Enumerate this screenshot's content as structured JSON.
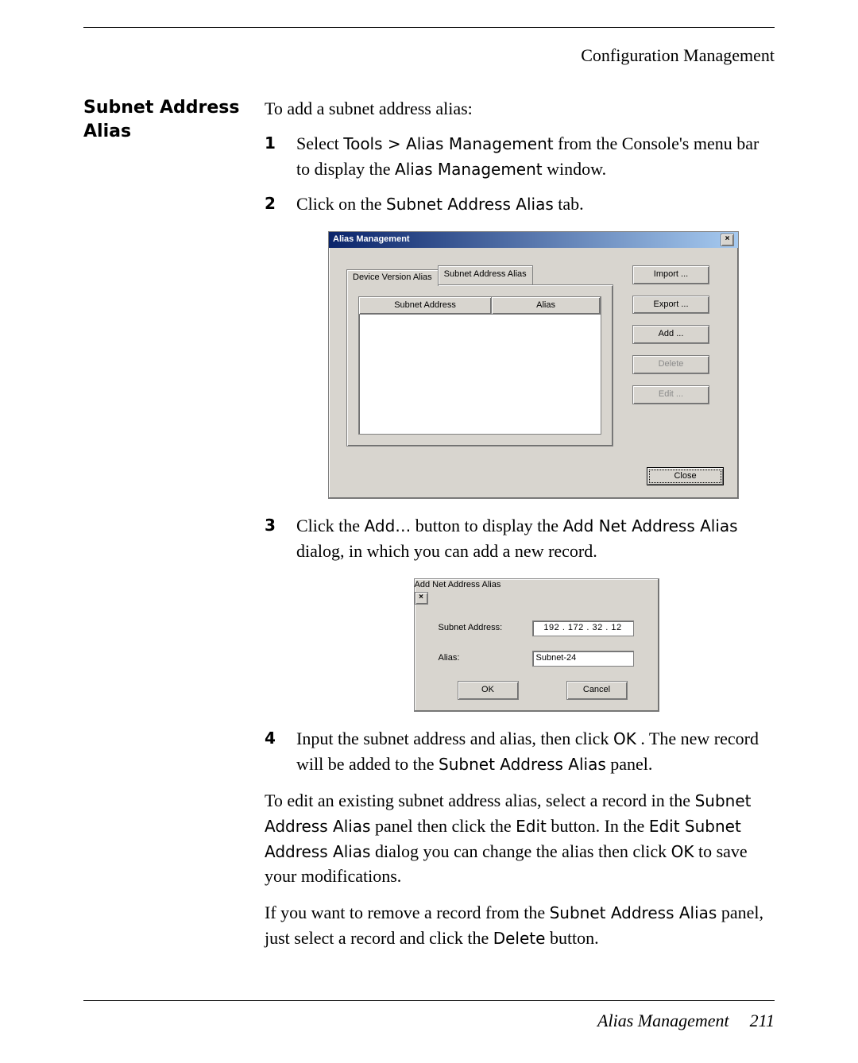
{
  "header": {
    "section": "Configuration Management"
  },
  "side_heading": "Subnet Address Alias",
  "intro": "To add a subnet address alias:",
  "steps": {
    "s1": {
      "t1": "Select ",
      "ui1": "Tools > Alias Management",
      "t2": " from the Console's menu bar to display the ",
      "ui2": "Alias Management",
      "t3": " window."
    },
    "s2": {
      "t1": "Click on the ",
      "ui1": "Subnet Address Alias",
      "t2": " tab."
    },
    "s3": {
      "t1": "Click the ",
      "ui1": "Add…",
      "t2": " button to display the ",
      "ui2": "Add Net Address Alias",
      "t3": " dialog, in which you can add a new record."
    },
    "s4": {
      "t1": "Input the subnet address and alias, then click ",
      "ui1": "OK",
      "t2": ". The new record will be added to the ",
      "ui2": "Subnet Address Alias",
      "t3": " panel."
    }
  },
  "edit_para": {
    "t1": "To edit an existing subnet address alias, select a record in the ",
    "ui1": "Subnet Address Alias",
    "t2": " panel then click the ",
    "ui2": "Edit",
    "t3": " button. In the ",
    "ui3": "Edit Subnet Address Alias",
    "t4": " dialog you can change the alias then click ",
    "ui4": "OK",
    "t5": " to save your modifications."
  },
  "delete_para": {
    "t1": "If you want to remove a record from the ",
    "ui1": "Subnet Address Alias",
    "t2": " panel, just select a record and click the ",
    "ui2": "Delete",
    "t3": " button."
  },
  "am_window": {
    "title": "Alias Management",
    "close_x": "×",
    "tab_inactive": "Device Version Alias",
    "tab_active": "Subnet Address Alias",
    "col1": "Subnet Address",
    "col2": "Alias",
    "btn_import": "Import  ...",
    "btn_export": "Export  ...",
    "btn_add": "Add  ...",
    "btn_delete": "Delete",
    "btn_edit": "Edit  ...",
    "btn_close": "Close"
  },
  "add_dialog": {
    "title": "Add Net Address Alias",
    "close_x": "×",
    "lbl_subnet": "Subnet Address:",
    "lbl_alias": "Alias:",
    "val_subnet": "192 . 172 .  32  .  12",
    "val_alias": "Subnet-24",
    "btn_ok": "OK",
    "btn_cancel": "Cancel"
  },
  "footer": {
    "title": "Alias Management",
    "page": "211"
  }
}
